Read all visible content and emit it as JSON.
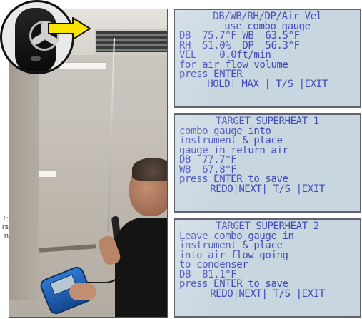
{
  "side_caption": {
    "lines": [
      "r-",
      "rs",
      "n"
    ]
  },
  "screens": [
    {
      "lines": [
        "DB/WB/RH/DP/Air Vel",
        "use combo gauge",
        "DB  75.7°F WB  63.5°F",
        "RH  51.0%  DP  56.3°F",
        "VEL    0.0ft/min",
        "for air flow volume",
        "press ENTER",
        "HOLD| MAX | T/S |EXIT"
      ]
    },
    {
      "lines": [
        "TARGET SUPERHEAT 1",
        "combo gauge into",
        "instrument & place",
        "gauge in return air",
        "DB  77.7°F",
        "WB  67.8°F",
        "press ENTER to save",
        "REDO|NEXT| T/S |EXIT"
      ]
    },
    {
      "lines": [
        "TARGET SUPERHEAT 2",
        "Leave combo gauge in",
        "instrument & place",
        "into air flow going",
        "to condenser",
        "DB  81.1°F",
        "press ENTER to save",
        "REDO|NEXT| T/S |EXIT"
      ]
    }
  ],
  "colors": {
    "lcd_background": "#c8d6e0",
    "lcd_text": "#3e4bb6",
    "arrow": "#f7e400"
  },
  "icons": {
    "inset": "anemometer-probe-fan-icon",
    "arrow": "right-arrow-icon"
  }
}
